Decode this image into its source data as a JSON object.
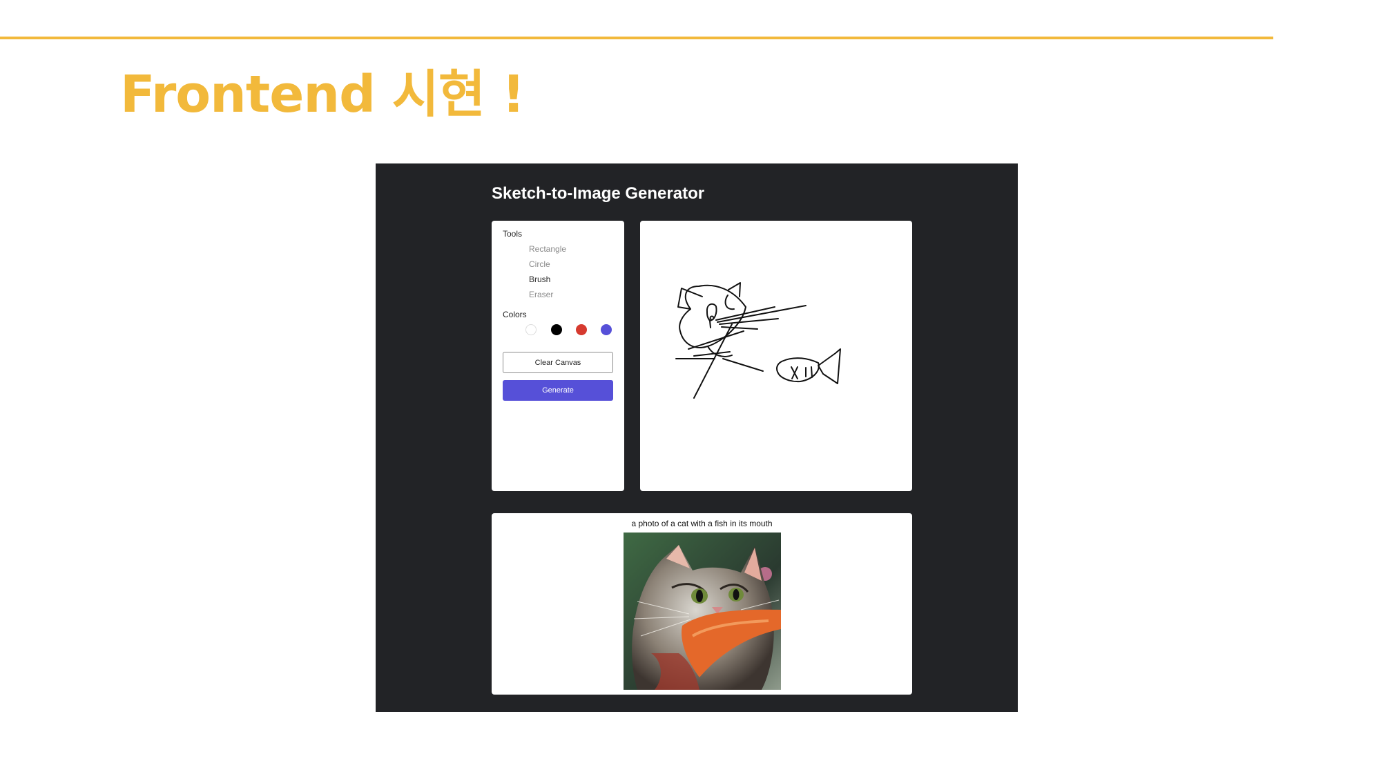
{
  "slide": {
    "title": "Frontend 시현 !"
  },
  "app": {
    "title": "Sketch-to-Image Generator",
    "tools": {
      "heading": "Tools",
      "items": [
        {
          "label": "Rectangle",
          "active": false
        },
        {
          "label": "Circle",
          "active": false
        },
        {
          "label": "Brush",
          "active": true
        },
        {
          "label": "Eraser",
          "active": false
        }
      ]
    },
    "colors": {
      "heading": "Colors",
      "swatches": [
        {
          "name": "white",
          "hex": "#ffffff"
        },
        {
          "name": "black",
          "hex": "#000000"
        },
        {
          "name": "red",
          "hex": "#d63a2f"
        },
        {
          "name": "blue",
          "hex": "#5650d8"
        }
      ]
    },
    "buttons": {
      "clear_label": "Clear Canvas",
      "generate_label": "Generate"
    },
    "result": {
      "caption": "a photo of a cat with a fish in its mouth"
    },
    "palette": {
      "accent": "#f2b93b",
      "primary": "#5650d8",
      "dark": "#222326"
    }
  }
}
